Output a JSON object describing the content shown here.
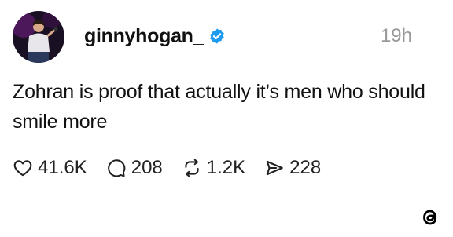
{
  "post": {
    "username": "ginnyhogan_",
    "timestamp": "19h",
    "text": "Zohran is proof that actually it’s men who should smile more",
    "verified_icon": "verified-badge-icon",
    "colors": {
      "verified": "#1d9bf0",
      "timestamp": "#999999"
    }
  },
  "actions": {
    "likes": {
      "icon": "heart-icon",
      "count": "41.6K"
    },
    "comments": {
      "icon": "comment-icon",
      "count": "208"
    },
    "reposts": {
      "icon": "repost-icon",
      "count": "1.2K"
    },
    "shares": {
      "icon": "share-icon",
      "count": "228"
    }
  },
  "brand": {
    "icon": "threads-logo-icon"
  }
}
